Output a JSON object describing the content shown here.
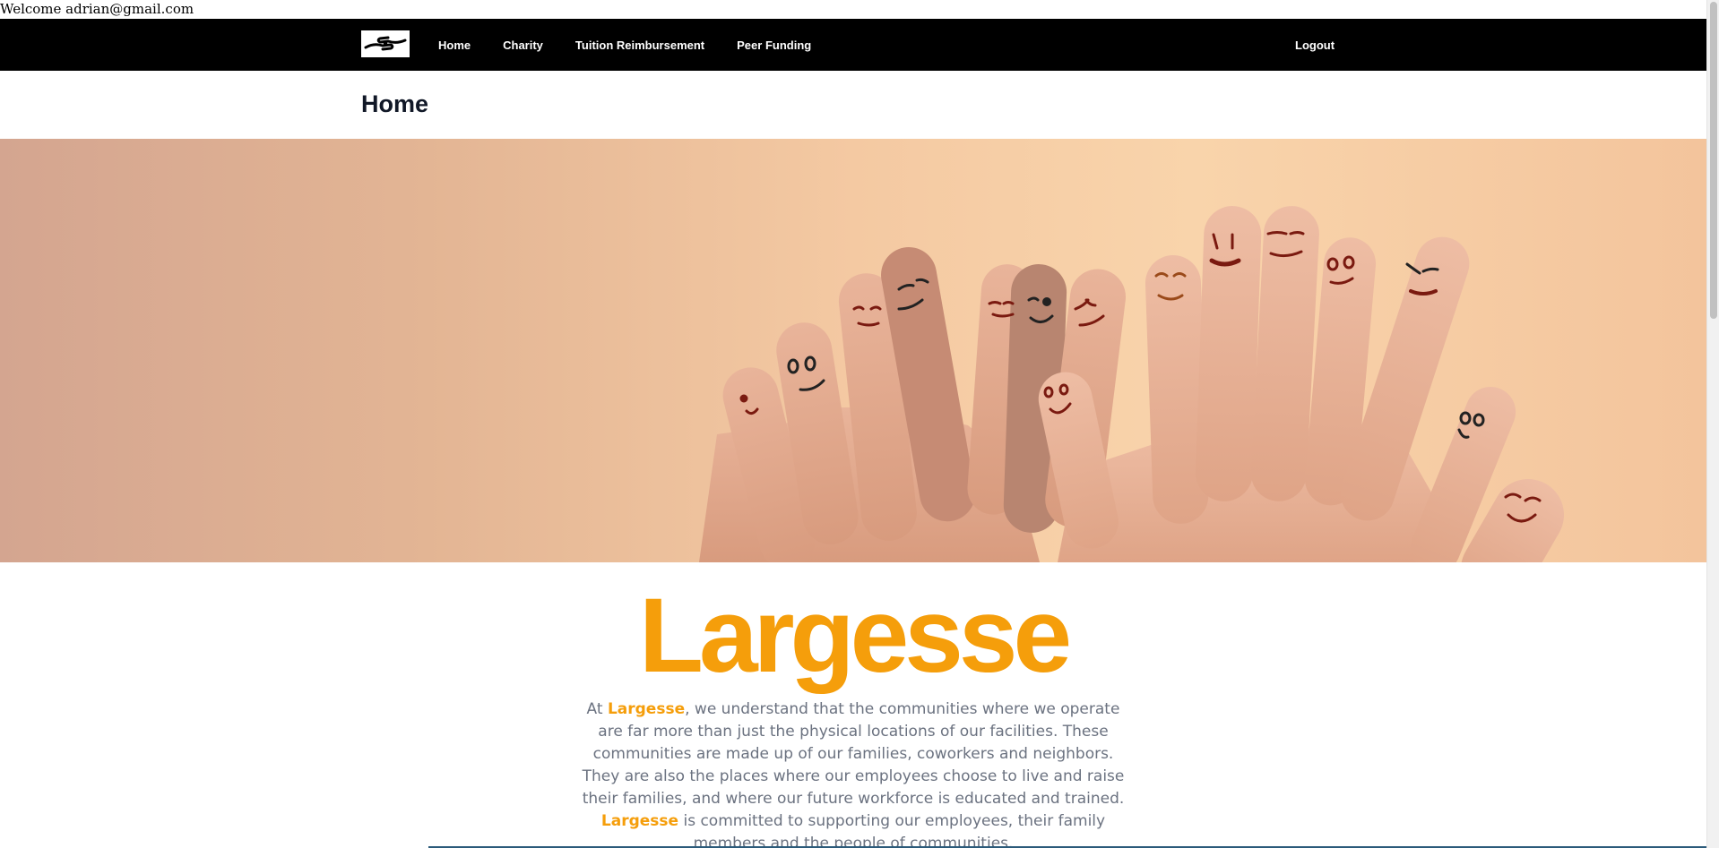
{
  "welcome": {
    "text": "Welcome adrian@gmail.com"
  },
  "nav": {
    "logo_icon": "helping-hands-icon",
    "items": [
      {
        "label": "Home"
      },
      {
        "label": "Charity"
      },
      {
        "label": "Tuition Reimbursement"
      },
      {
        "label": "Peer Funding"
      }
    ],
    "logout": "Logout"
  },
  "page": {
    "title": "Home"
  },
  "hero": {
    "image": "smiling-fingers-hands-illustration"
  },
  "brand": {
    "name": "Largesse"
  },
  "intro": {
    "part1": "At ",
    "brand1": "Largesse",
    "part2": ", we understand that the communities where we operate are far more than just the physical locations of our facilities. These communities are made up of our families, coworkers and neighbors. They are also the places where our employees choose to live and raise their families, and where our future workforce is educated and trained. ",
    "brand2": "Largesse",
    "part3": " is committed to supporting our employees, their family members and the people of communities."
  },
  "colors": {
    "brand": "#f59e0b",
    "nav_bg": "#000000",
    "text_muted": "#6b7280"
  }
}
